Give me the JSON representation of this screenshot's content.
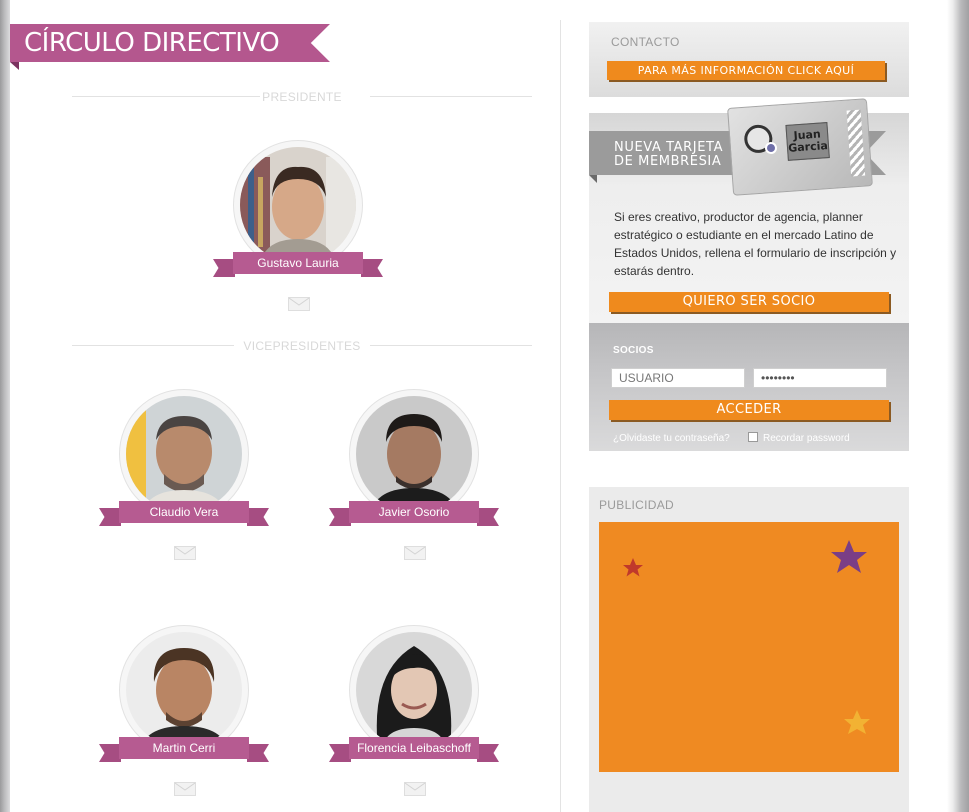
{
  "page": {
    "title": "CÍRCULO DIRECTIVO"
  },
  "sections": {
    "president": "PRESIDENTE",
    "vicepresidents": "VICEPRESIDENTES"
  },
  "people": {
    "president": {
      "name": "Gustavo Lauria"
    },
    "vp1": {
      "name": "Claudio Vera"
    },
    "vp2": {
      "name": "Javier Osorio"
    },
    "vp3": {
      "name": "Martin Cerri"
    },
    "vp4": {
      "name": "Florencia Leibaschoff"
    }
  },
  "sidebar": {
    "contact": {
      "label": "CONTACTO",
      "button": "PARA MÁS INFORMACIÓN CLICK AQUÍ"
    },
    "membership": {
      "banner_line1": "NUEVA TARJETA",
      "banner_line2": "DE MEMBRESIA",
      "card_name_1": "Juan",
      "card_name_2": "Garcia",
      "description": "Si eres creativo, productor de agencia, planner estratégico o estudiante en el mercado Latino de Estados Unidos, rellena el formulario de inscripción y estarás dentro.",
      "cta": "QUIERO SER SOCIO"
    },
    "login": {
      "label": "SOCIOS",
      "user_placeholder": "USUARIO",
      "password_value": "••••••••",
      "submit": "ACCEDER",
      "forgot": "¿Olvidaste tu contraseña?",
      "remember": "Recordar password"
    },
    "ad": {
      "label": "PUBLICIDAD"
    }
  },
  "colors": {
    "brand_pink": "#b4578e",
    "accent_orange": "#ef8a1d",
    "ad_star_purple": "#7a3e86",
    "ad_star_red": "#c0392b",
    "ad_star_yellow": "#f2b233"
  },
  "icons": {
    "mail": "envelope-icon",
    "star": "star-icon"
  }
}
